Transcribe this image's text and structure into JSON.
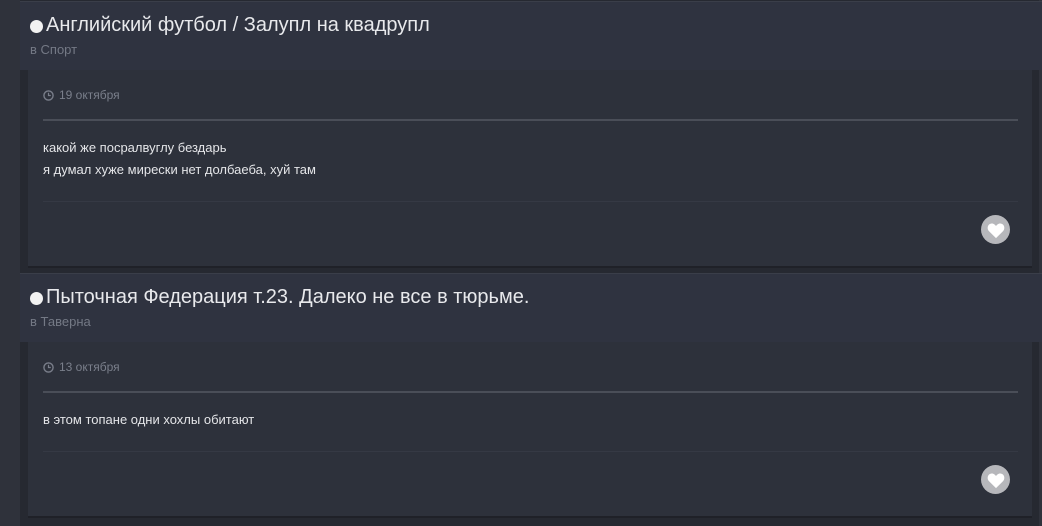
{
  "results": [
    {
      "topic_title": "Английский футбол / Залупл на квадрупл",
      "forum_line": "в Спорт",
      "date": "19 октября",
      "lines": [
        "какой же посралвуглу бездарь",
        "я думал хуже миреcки нет долбаеба, хуй там"
      ]
    },
    {
      "topic_title": "Пыточная Федерация т.23. Далеко не все в тюрьме.",
      "forum_line": "в Таверна",
      "date": "13 октября",
      "lines": [
        "в этом топане одни хохлы обитают"
      ]
    }
  ],
  "icons": {
    "bullet": "bullet-dot-icon",
    "date": "clock-icon",
    "like": "heart-icon"
  },
  "colors": {
    "background": "#262931",
    "header": "#2f3340",
    "post": "#2d313b",
    "text": "#e4e5e8",
    "muted": "#747985"
  }
}
